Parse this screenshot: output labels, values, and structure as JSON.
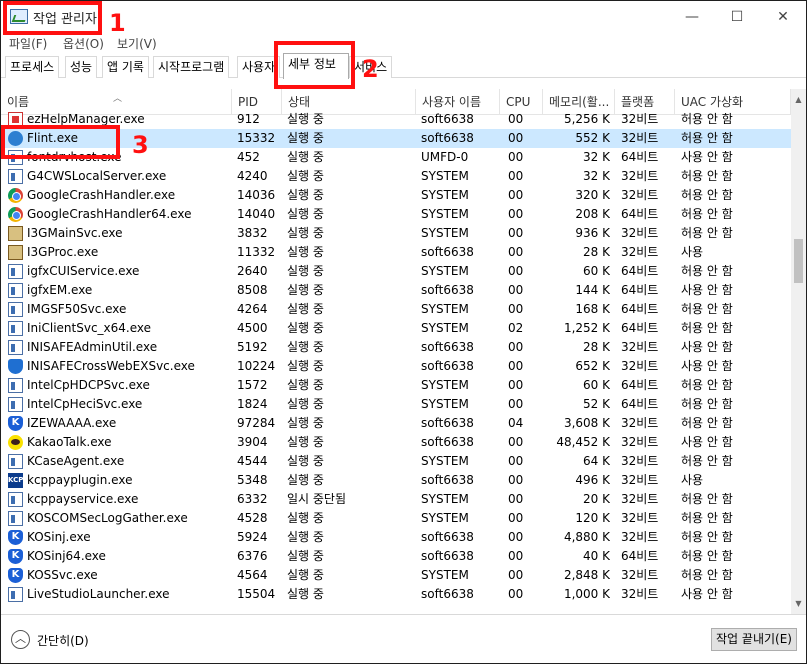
{
  "window": {
    "title": "작업 관리자",
    "controls": {
      "minimize": "—",
      "maximize": "☐",
      "close": "✕"
    }
  },
  "menu": [
    "파일(F)",
    "옵션(O)",
    "보기(V)"
  ],
  "tabs": [
    {
      "label": "프로세스",
      "active": false
    },
    {
      "label": "성능",
      "active": false
    },
    {
      "label": "앱 기록",
      "active": false
    },
    {
      "label": "시작프로그램",
      "active": false
    },
    {
      "label": "사용자",
      "active": false
    },
    {
      "label": "세부 정보",
      "active": true
    },
    {
      "label": "서비스",
      "active": false
    }
  ],
  "columns": {
    "name": "이름",
    "pid": "PID",
    "status": "상태",
    "user": "사용자 이름",
    "cpu": "CPU",
    "memory": "메모리(활...",
    "platform": "플랫폼",
    "uac": "UAC 가상화"
  },
  "rows": [
    {
      "name": "ezHelpManager.exe",
      "pid": "912",
      "status": "실행 중",
      "user": "soft6638",
      "cpu": "00",
      "memory": "5,256 K",
      "platform": "32비트",
      "uac": "허용 안 함",
      "icon": "red-app-icon"
    },
    {
      "name": "Flint.exe",
      "pid": "15332",
      "status": "실행 중",
      "user": "soft6638",
      "cpu": "00",
      "memory": "552 K",
      "platform": "32비트",
      "uac": "허용 안 함",
      "icon": "flint-icon",
      "selected": true
    },
    {
      "name": "fontdrvhost.exe",
      "pid": "452",
      "status": "실행 중",
      "user": "UMFD-0",
      "cpu": "00",
      "memory": "32 K",
      "platform": "64비트",
      "uac": "사용 안 함",
      "icon": "exe-icon"
    },
    {
      "name": "G4CWSLocalServer.exe",
      "pid": "4240",
      "status": "실행 중",
      "user": "SYSTEM",
      "cpu": "00",
      "memory": "32 K",
      "platform": "32비트",
      "uac": "허용 안 함",
      "icon": "exe-icon"
    },
    {
      "name": "GoogleCrashHandler.exe",
      "pid": "14036",
      "status": "실행 중",
      "user": "SYSTEM",
      "cpu": "00",
      "memory": "320 K",
      "platform": "32비트",
      "uac": "허용 안 함",
      "icon": "chrome-icon"
    },
    {
      "name": "GoogleCrashHandler64.exe",
      "pid": "14040",
      "status": "실행 중",
      "user": "SYSTEM",
      "cpu": "00",
      "memory": "208 K",
      "platform": "64비트",
      "uac": "허용 안 함",
      "icon": "chrome-icon"
    },
    {
      "name": "I3GMainSvc.exe",
      "pid": "3832",
      "status": "실행 중",
      "user": "SYSTEM",
      "cpu": "00",
      "memory": "936 K",
      "platform": "32비트",
      "uac": "허용 안 함",
      "icon": "i3g-icon"
    },
    {
      "name": "I3GProc.exe",
      "pid": "11332",
      "status": "실행 중",
      "user": "soft6638",
      "cpu": "00",
      "memory": "28 K",
      "platform": "32비트",
      "uac": "사용",
      "icon": "i3g-icon"
    },
    {
      "name": "igfxCUIService.exe",
      "pid": "2640",
      "status": "실행 중",
      "user": "SYSTEM",
      "cpu": "00",
      "memory": "60 K",
      "platform": "64비트",
      "uac": "허용 안 함",
      "icon": "exe-icon"
    },
    {
      "name": "igfxEM.exe",
      "pid": "8508",
      "status": "실행 중",
      "user": "soft6638",
      "cpu": "00",
      "memory": "144 K",
      "platform": "64비트",
      "uac": "사용 안 함",
      "icon": "intel-icon"
    },
    {
      "name": "IMGSF50Svc.exe",
      "pid": "4264",
      "status": "실행 중",
      "user": "SYSTEM",
      "cpu": "00",
      "memory": "168 K",
      "platform": "64비트",
      "uac": "허용 안 함",
      "icon": "exe-icon"
    },
    {
      "name": "IniClientSvc_x64.exe",
      "pid": "4500",
      "status": "실행 중",
      "user": "SYSTEM",
      "cpu": "02",
      "memory": "1,252 K",
      "platform": "64비트",
      "uac": "허용 안 함",
      "icon": "exe-icon"
    },
    {
      "name": "INISAFEAdminUtil.exe",
      "pid": "5192",
      "status": "실행 중",
      "user": "soft6638",
      "cpu": "00",
      "memory": "28 K",
      "platform": "32비트",
      "uac": "사용 안 함",
      "icon": "exe-icon"
    },
    {
      "name": "INISAFECrossWebEXSvc.exe",
      "pid": "10224",
      "status": "실행 중",
      "user": "soft6638",
      "cpu": "00",
      "memory": "652 K",
      "platform": "32비트",
      "uac": "사용 안 함",
      "icon": "shield-icon"
    },
    {
      "name": "IntelCpHDCPSvc.exe",
      "pid": "1572",
      "status": "실행 중",
      "user": "SYSTEM",
      "cpu": "00",
      "memory": "60 K",
      "platform": "64비트",
      "uac": "허용 안 함",
      "icon": "exe-icon"
    },
    {
      "name": "IntelCpHeciSvc.exe",
      "pid": "1824",
      "status": "실행 중",
      "user": "SYSTEM",
      "cpu": "00",
      "memory": "52 K",
      "platform": "64비트",
      "uac": "허용 안 함",
      "icon": "exe-icon"
    },
    {
      "name": "IZEWAAAA.exe",
      "pid": "97284",
      "status": "실행 중",
      "user": "soft6638",
      "cpu": "04",
      "memory": "3,608 K",
      "platform": "32비트",
      "uac": "허용 안 함",
      "icon": "k-icon"
    },
    {
      "name": "KakaoTalk.exe",
      "pid": "3904",
      "status": "실행 중",
      "user": "soft6638",
      "cpu": "00",
      "memory": "48,452 K",
      "platform": "32비트",
      "uac": "사용 안 함",
      "icon": "kakao-icon"
    },
    {
      "name": "KCaseAgent.exe",
      "pid": "4544",
      "status": "실행 중",
      "user": "SYSTEM",
      "cpu": "00",
      "memory": "64 K",
      "platform": "32비트",
      "uac": "허용 안 함",
      "icon": "exe-icon"
    },
    {
      "name": "kcppayplugin.exe",
      "pid": "5348",
      "status": "실행 중",
      "user": "soft6638",
      "cpu": "00",
      "memory": "496 K",
      "platform": "32비트",
      "uac": "사용",
      "icon": "kcp-icon"
    },
    {
      "name": "kcppayservice.exe",
      "pid": "6332",
      "status": "일시 중단됨",
      "user": "SYSTEM",
      "cpu": "00",
      "memory": "20 K",
      "platform": "32비트",
      "uac": "허용 안 함",
      "icon": "exe-icon"
    },
    {
      "name": "KOSCOMSecLogGather.exe",
      "pid": "4528",
      "status": "실행 중",
      "user": "SYSTEM",
      "cpu": "00",
      "memory": "120 K",
      "platform": "32비트",
      "uac": "허용 안 함",
      "icon": "exe-icon"
    },
    {
      "name": "KOSinj.exe",
      "pid": "5924",
      "status": "실행 중",
      "user": "soft6638",
      "cpu": "00",
      "memory": "4,880 K",
      "platform": "32비트",
      "uac": "허용 안 함",
      "icon": "k-icon"
    },
    {
      "name": "KOSinj64.exe",
      "pid": "6376",
      "status": "실행 중",
      "user": "soft6638",
      "cpu": "00",
      "memory": "40 K",
      "platform": "64비트",
      "uac": "허용 안 함",
      "icon": "k-icon"
    },
    {
      "name": "KOSSvc.exe",
      "pid": "4564",
      "status": "실행 중",
      "user": "SYSTEM",
      "cpu": "00",
      "memory": "2,848 K",
      "platform": "32비트",
      "uac": "허용 안 함",
      "icon": "k-icon"
    },
    {
      "name": "LiveStudioLauncher.exe",
      "pid": "15504",
      "status": "실행 중",
      "user": "soft6638",
      "cpu": "00",
      "memory": "1,000 K",
      "platform": "32비트",
      "uac": "사용 안 함",
      "icon": "exe-icon"
    }
  ],
  "footer": {
    "collapse_label": "간단히(D)",
    "end_task_label": "작업 끝내기(E)"
  },
  "annotations": [
    "1",
    "2",
    "3"
  ],
  "accent_color": "#ff1010",
  "selection_color": "#cce8ff"
}
